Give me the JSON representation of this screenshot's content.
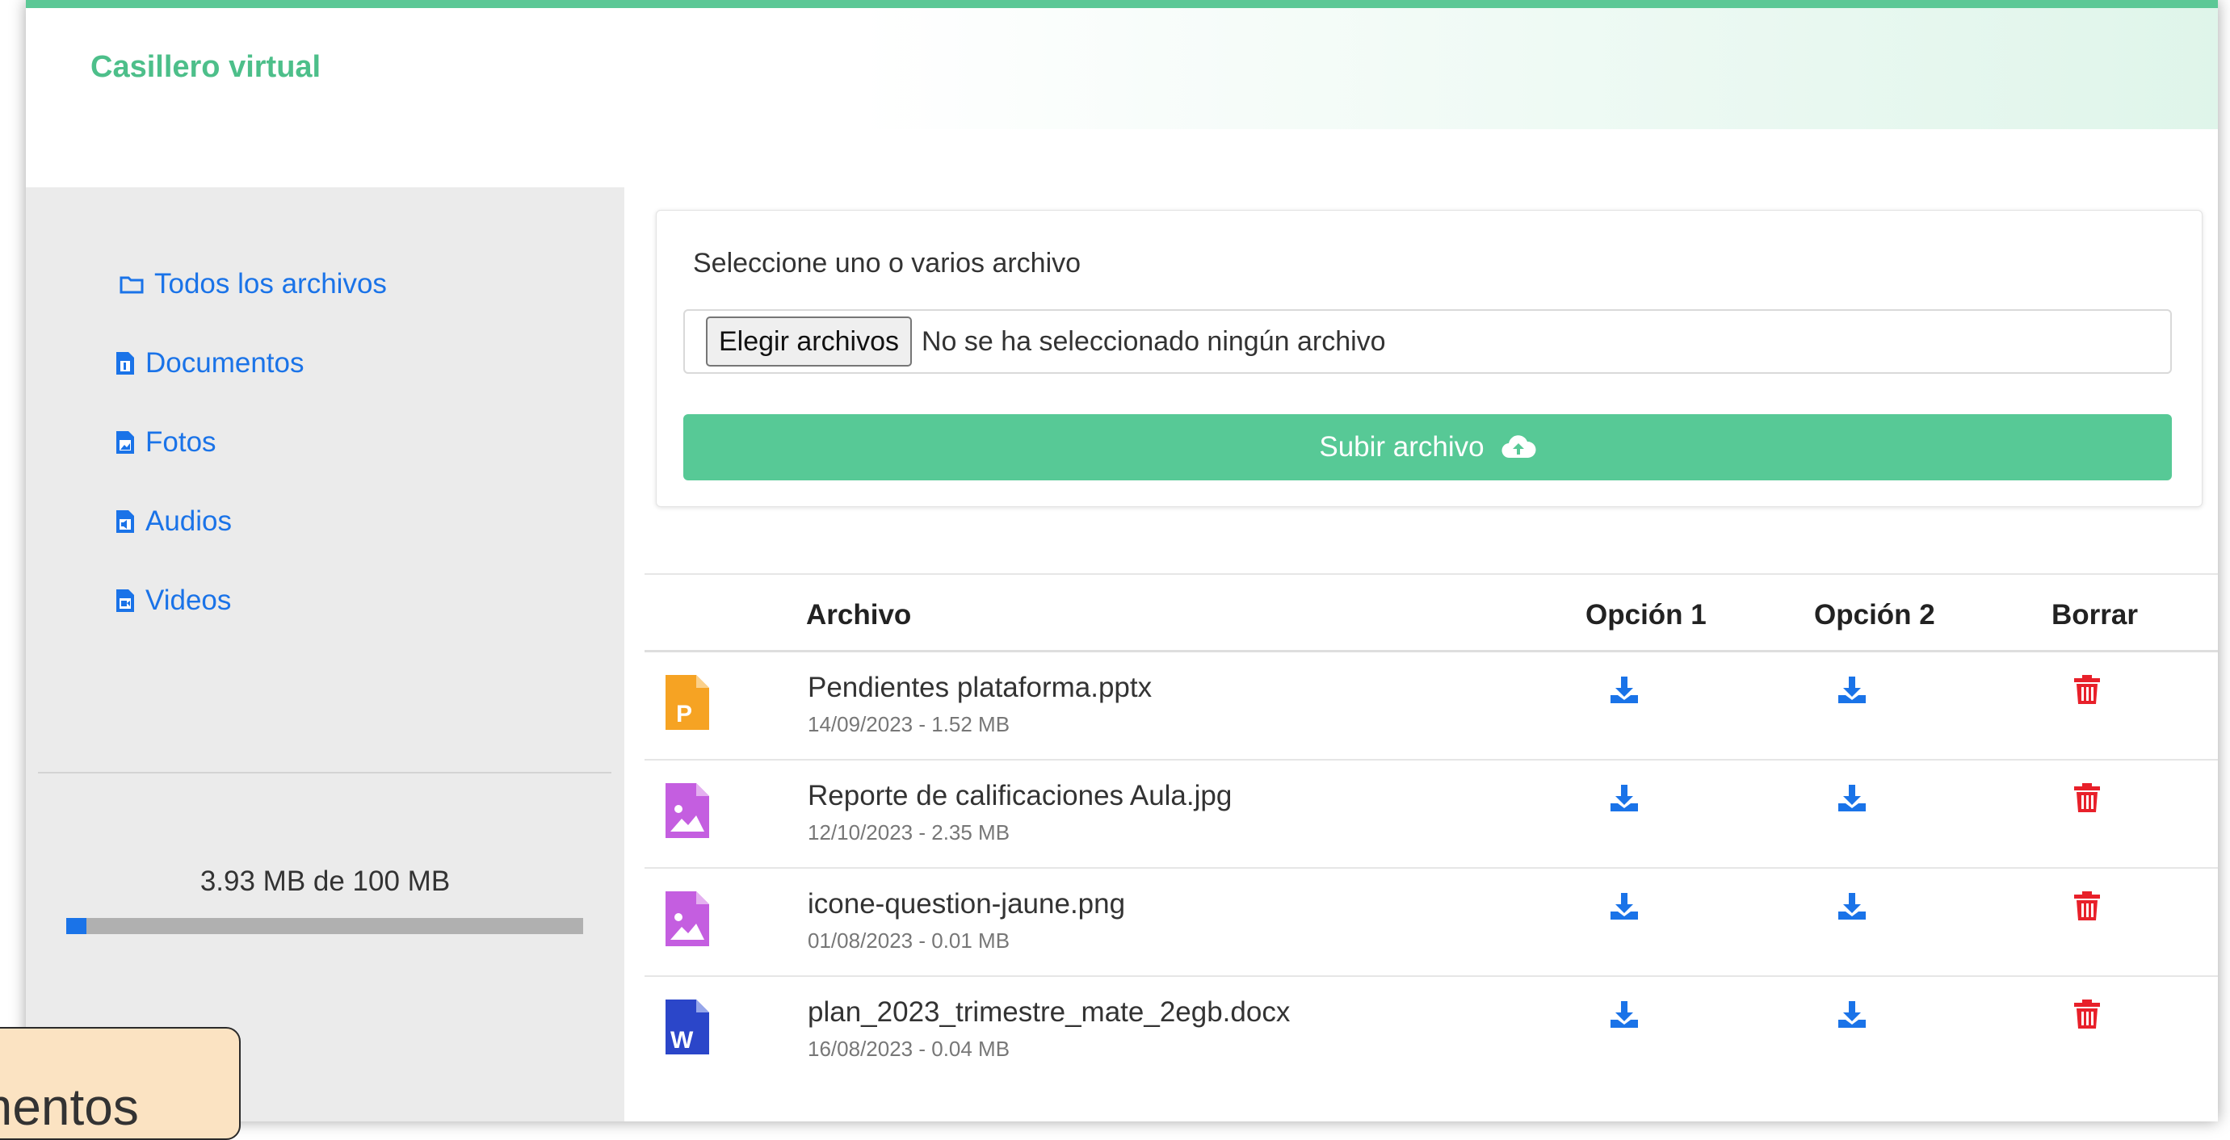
{
  "header": {
    "title": "Casillero virtual"
  },
  "sidebar": {
    "items": [
      {
        "label": "Todos los archivos",
        "icon": "folder-icon"
      },
      {
        "label": "Documentos",
        "icon": "document-icon"
      },
      {
        "label": "Fotos",
        "icon": "image-file-icon"
      },
      {
        "label": "Audios",
        "icon": "audio-file-icon"
      },
      {
        "label": "Videos",
        "icon": "video-file-icon"
      }
    ],
    "storage": {
      "text": "3.93 MB de 100 MB",
      "used_fraction": 0.0393
    }
  },
  "upload": {
    "label": "Seleccione uno o varios archivo",
    "choose_button": "Elegir archivos",
    "no_file": "No se ha seleccionado ningún archivo",
    "submit_label": "Subir archivo",
    "submit_icon": "cloud-upload-icon"
  },
  "table": {
    "headers": {
      "file": "Archivo",
      "option1": "Opción 1",
      "option2": "Opción 2",
      "delete": "Borrar"
    },
    "rows": [
      {
        "name": "Pendientes plataforma.pptx",
        "meta": "14/09/2023 - 1.52 MB",
        "type": "pptx-file-icon"
      },
      {
        "name": "Reporte de calificaciones Aula.jpg",
        "meta": "12/10/2023 - 2.35 MB",
        "type": "image-file-icon"
      },
      {
        "name": "icone-question-jaune.png",
        "meta": "01/08/2023 - 0.01 MB",
        "type": "image-file-icon"
      },
      {
        "name": "plan_2023_trimestre_mate_2egb.docx",
        "meta": "16/08/2023 - 0.04 MB",
        "type": "docx-file-icon"
      }
    ]
  },
  "toast": {
    "text": "mentos"
  },
  "colors": {
    "accent": "#57c996",
    "title": "#4dbf8a",
    "link": "#1a73e8",
    "delete": "#e8202a",
    "pptx": "#f6a323",
    "image": "#c45ee0",
    "docx": "#2b46c9"
  }
}
